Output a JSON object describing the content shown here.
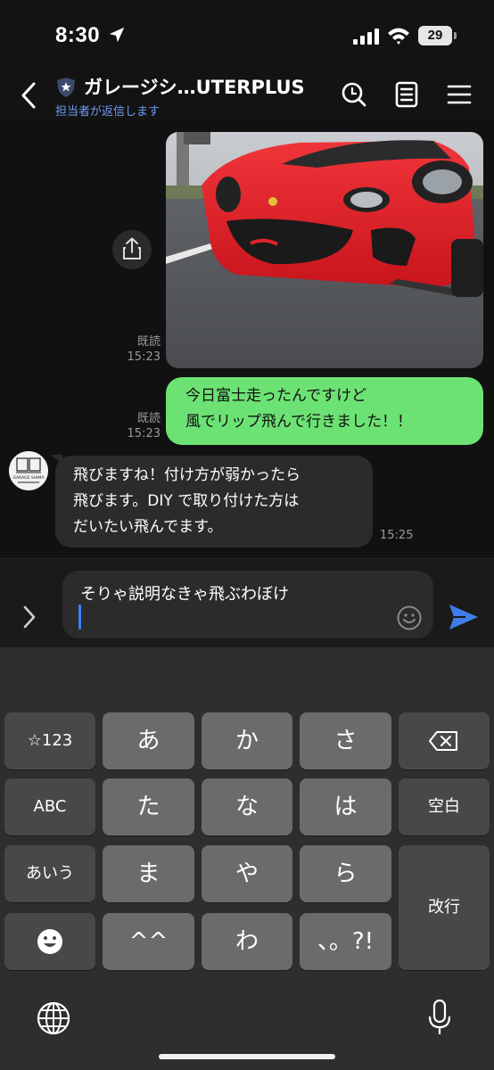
{
  "status": {
    "time": "8:30",
    "battery": "29"
  },
  "header": {
    "title": "ガレージシ…UTERPLUS",
    "subtitle": "担当者が返信します"
  },
  "messages": {
    "photo_read": "既読",
    "photo_time": "15:23",
    "out_read": "既読",
    "out_time": "15:23",
    "out_lines": [
      "今日富士走ったんですけど",
      "風でリップ飛んで行きました！！"
    ],
    "in_lines": [
      "飛びますね！付け方が弱かったら",
      "飛びます。DIY で取り付けた方は",
      "だいたい飛んでます。"
    ],
    "in_time": "15:25",
    "avatar_text": "GARAGE SHIMA"
  },
  "input": {
    "value": "そりゃ説明なきゃ飛ぶわぼけ"
  },
  "keyboard": {
    "row1": [
      "☆123",
      "あ",
      "か",
      "さ"
    ],
    "row2": [
      "ABC",
      "た",
      "な",
      "は",
      "空白"
    ],
    "row3": [
      "あいう",
      "ま",
      "や",
      "ら"
    ],
    "row4": [
      "^^",
      "わ",
      "、。?!"
    ],
    "enter": "改行"
  },
  "colors": {
    "sent_bubble": "#6de274",
    "received_bubble": "#2b2b2b",
    "accent": "#3b82f6",
    "subtitle": "#6f9bf2"
  },
  "icons": [
    "location-arrow-icon",
    "signal-icon",
    "wifi-icon",
    "back-icon",
    "shield-icon",
    "search-icon",
    "notes-icon",
    "menu-icon",
    "share-icon",
    "expand-icon",
    "emoji-icon",
    "send-icon",
    "backspace-icon",
    "emoji-key-icon",
    "globe-icon",
    "mic-icon"
  ]
}
